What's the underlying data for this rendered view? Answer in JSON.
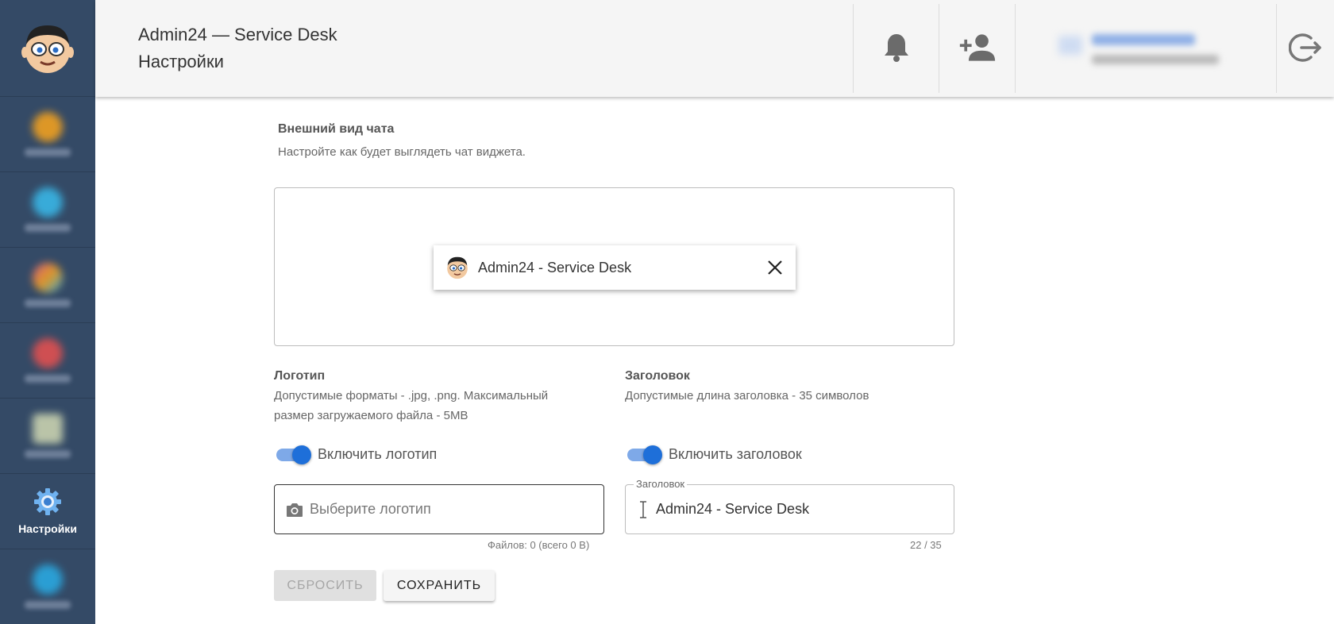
{
  "app": {
    "title": "Admin24 — Service Desk",
    "subtitle": "Настройки"
  },
  "sidebar": {
    "items": [
      {
        "icon": "tasks-icon",
        "color": "#f0a020"
      },
      {
        "icon": "messages-icon",
        "color": "#39b6e6"
      },
      {
        "icon": "knowledge-icon",
        "color": "#e65a8a"
      },
      {
        "icon": "clients-icon",
        "color": "#e05050"
      },
      {
        "icon": "reports-icon",
        "color": "#c9d2b0"
      },
      {
        "icon": "gear-icon",
        "label": "Настройки",
        "active": true
      },
      {
        "icon": "support-icon",
        "color": "#2aa8e0"
      }
    ]
  },
  "section": {
    "title": "Внешний вид чата",
    "description": "Настройте как будет выглядеть чат виджета."
  },
  "preview": {
    "chat_title": "Admin24 - Service Desk"
  },
  "logo": {
    "title": "Логотип",
    "description_line1": "Допустимые форматы - .jpg, .png. Максимальный",
    "description_line2": "размер загружаемого файла - 5MB",
    "toggle_label": "Включить логотип",
    "toggle_on": true,
    "input_placeholder": "Выберите логотип",
    "files_hint": "Файлов: 0 (всего 0 B)"
  },
  "heading": {
    "title": "Заголовок",
    "description": "Допустимые длина заголовка - 35 символов",
    "toggle_label": "Включить заголовок",
    "toggle_on": true,
    "field_legend": "Заголовок",
    "field_value": "Admin24 - Service Desk",
    "counter": "22 / 35"
  },
  "actions": {
    "reset_label": "СБРОСИТЬ",
    "save_label": "СОХРАНИТЬ"
  },
  "colors": {
    "sidebar": "#344a66",
    "accent": "#1e6fd9"
  }
}
